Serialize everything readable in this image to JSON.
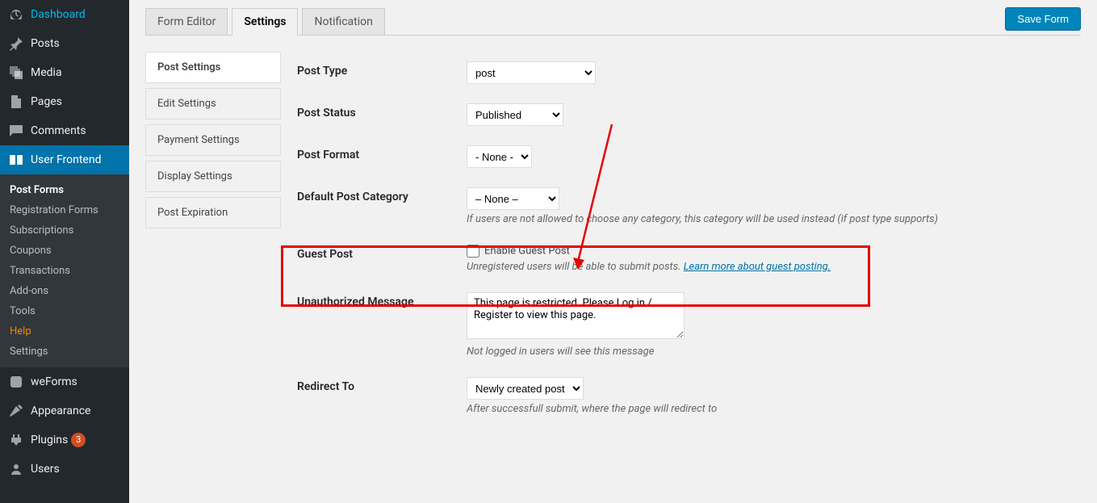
{
  "sidebar": {
    "items": [
      {
        "label": "Dashboard"
      },
      {
        "label": "Posts"
      },
      {
        "label": "Media"
      },
      {
        "label": "Pages"
      },
      {
        "label": "Comments"
      },
      {
        "label": "User Frontend"
      },
      {
        "label": "weForms"
      },
      {
        "label": "Appearance"
      },
      {
        "label": "Plugins",
        "badge": "3"
      },
      {
        "label": "Users"
      }
    ],
    "sub": [
      {
        "label": "Post Forms"
      },
      {
        "label": "Registration Forms"
      },
      {
        "label": "Subscriptions"
      },
      {
        "label": "Coupons"
      },
      {
        "label": "Transactions"
      },
      {
        "label": "Add-ons"
      },
      {
        "label": "Tools"
      },
      {
        "label": "Help"
      },
      {
        "label": "Settings"
      }
    ]
  },
  "tabs": {
    "form_editor": "Form Editor",
    "settings": "Settings",
    "notification": "Notification"
  },
  "save_button": "Save Form",
  "settings_nav": {
    "post_settings": "Post Settings",
    "edit_settings": "Edit Settings",
    "payment_settings": "Payment Settings",
    "display_settings": "Display Settings",
    "post_expiration": "Post Expiration"
  },
  "fields": {
    "post_type": {
      "label": "Post Type",
      "value": "post"
    },
    "post_status": {
      "label": "Post Status",
      "value": "Published"
    },
    "post_format": {
      "label": "Post Format",
      "value": "- None -"
    },
    "default_category": {
      "label": "Default Post Category",
      "value": "– None –",
      "help": "If users are not allowed to choose any category, this category will be used instead (if post type supports)"
    },
    "guest_post": {
      "label": "Guest Post",
      "checkbox_label": "Enable Guest Post",
      "help": "Unregistered users will be able to submit posts. ",
      "link": "Learn more about guest posting."
    },
    "unauthorized_msg": {
      "label": "Unauthorized Message",
      "value": "This page is restricted. Please Log in / Register to view this page.",
      "help": "Not logged in users will see this message"
    },
    "redirect_to": {
      "label": "Redirect To",
      "value": "Newly created post",
      "help": "After successfull submit, where the page will redirect to"
    }
  }
}
